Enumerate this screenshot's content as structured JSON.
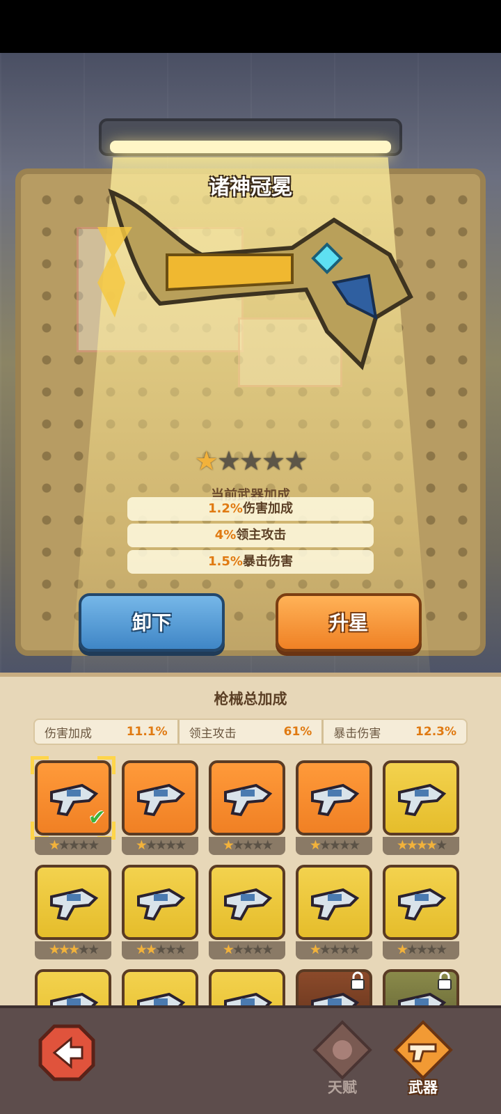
{
  "weapon": {
    "name": "诸神冠冕",
    "stars": 1,
    "max_stars": 5,
    "bonus_title": "当前武器加成",
    "bonuses": [
      {
        "value": "1.2%",
        "label": "伤害加成"
      },
      {
        "value": "4%",
        "label": "领主攻击"
      },
      {
        "value": "1.5%",
        "label": "暴击伤害"
      }
    ]
  },
  "actions": {
    "unequip_label": "卸下",
    "upgrade_label": "升星"
  },
  "totals": {
    "title": "枪械总加成",
    "items": [
      {
        "label": "伤害加成",
        "value": "11.1%"
      },
      {
        "label": "领主攻击",
        "value": "61%"
      },
      {
        "label": "暴击伤害",
        "value": "12.3%"
      }
    ]
  },
  "weapons_grid": [
    {
      "rarity": "orange",
      "stars": 1,
      "selected": true,
      "equipped": true,
      "locked": false,
      "icon": "golden-crown-gun-icon"
    },
    {
      "rarity": "orange",
      "stars": 1,
      "selected": false,
      "equipped": false,
      "locked": false,
      "icon": "teal-shotgun-icon"
    },
    {
      "rarity": "orange",
      "stars": 1,
      "selected": false,
      "equipped": false,
      "locked": false,
      "icon": "red-blaster-icon"
    },
    {
      "rarity": "orange",
      "stars": 1,
      "selected": false,
      "equipped": false,
      "locked": false,
      "icon": "white-gold-gun-icon"
    },
    {
      "rarity": "yellow",
      "stars": 4,
      "selected": false,
      "equipped": false,
      "locked": false,
      "icon": "red-launcher-icon"
    },
    {
      "rarity": "yellow",
      "stars": 3,
      "selected": false,
      "equipped": false,
      "locked": false,
      "icon": "silver-rifle-icon"
    },
    {
      "rarity": "yellow",
      "stars": 2,
      "selected": false,
      "equipped": false,
      "locked": false,
      "icon": "wrench-gun-icon"
    },
    {
      "rarity": "yellow",
      "stars": 1,
      "selected": false,
      "equipped": false,
      "locked": false,
      "icon": "turtle-cannon-icon"
    },
    {
      "rarity": "yellow",
      "stars": 1,
      "selected": false,
      "equipped": false,
      "locked": false,
      "icon": "dragon-gun-icon"
    },
    {
      "rarity": "yellow",
      "stars": 1,
      "selected": false,
      "equipped": false,
      "locked": false,
      "icon": "bear-bazooka-icon"
    },
    {
      "rarity": "yellow",
      "stars": 0,
      "selected": false,
      "equipped": false,
      "locked": false,
      "icon": "candy-gun-icon"
    },
    {
      "rarity": "yellow",
      "stars": 0,
      "selected": false,
      "equipped": false,
      "locked": false,
      "icon": "teddy-gun-icon"
    },
    {
      "rarity": "yellow",
      "stars": 0,
      "selected": false,
      "equipped": false,
      "locked": false,
      "icon": "purple-blaster-icon"
    },
    {
      "rarity": "dark",
      "stars": 0,
      "selected": false,
      "equipped": false,
      "locked": true,
      "icon": "dark-blade-gun-icon"
    },
    {
      "rarity": "olive",
      "stars": 0,
      "selected": false,
      "equipped": false,
      "locked": true,
      "icon": "blue-cannon-icon"
    }
  ],
  "nav": {
    "talent_label": "天赋",
    "weapon_label": "武器",
    "active": "weapon"
  },
  "colors": {
    "accent_orange": "#e07a12",
    "star_gold": "#f2b23b",
    "button_blue": "#3f86c6",
    "button_orange": "#ef8125"
  }
}
